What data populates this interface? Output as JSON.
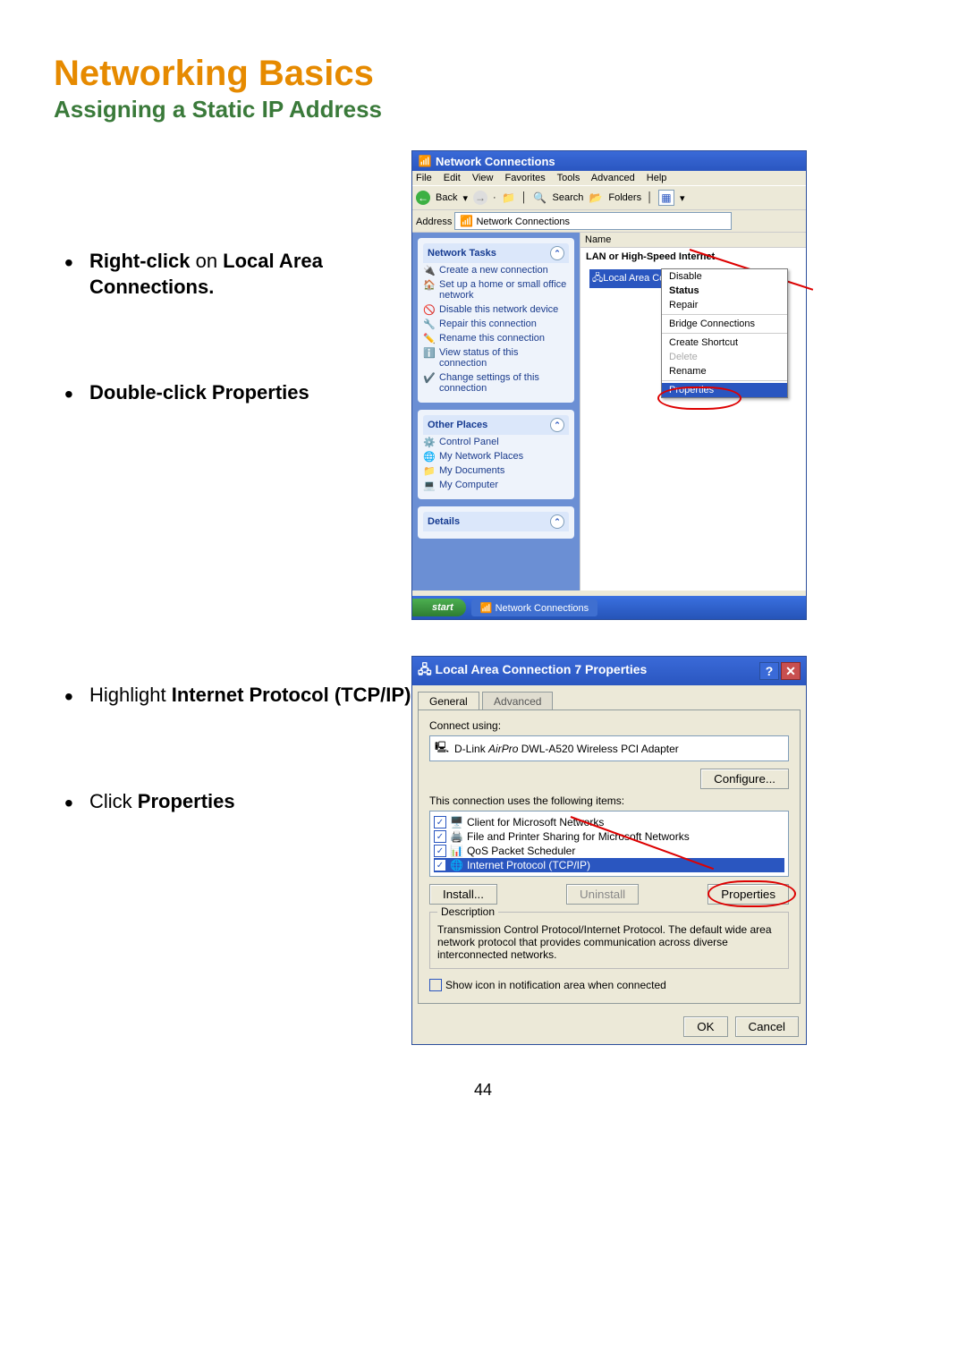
{
  "page": {
    "title": "Networking Basics",
    "subtitle": "Assigning a Static IP Address",
    "number": "44"
  },
  "instructions": {
    "step1a": "Right-click",
    "step1b": " on ",
    "step1c": "Local Area Connections.",
    "step2a": "Double-click Properties",
    "step3a": "Highlight ",
    "step3b": "Internet Protocol (TCP/IP)",
    "step4a": "Click ",
    "step4b": "Properties"
  },
  "nc": {
    "title": "Network Connections",
    "menu": {
      "file": "File",
      "edit": "Edit",
      "view": "View",
      "fav": "Favorites",
      "tools": "Tools",
      "adv": "Advanced",
      "help": "Help"
    },
    "tb": {
      "back": "Back",
      "search": "Search",
      "folders": "Folders"
    },
    "addr_label": "Address",
    "addr_value": "Network Connections",
    "col_name": "Name",
    "group": "LAN or High-Speed Internet",
    "conn": "Local Area Conn",
    "tasks_hdr": "Network Tasks",
    "tasks": [
      "Create a new connection",
      "Set up a home or small office network",
      "Disable this network device",
      "Repair this connection",
      "Rename this connection",
      "View status of this connection",
      "Change settings of this connection"
    ],
    "other_hdr": "Other Places",
    "other": [
      "Control Panel",
      "My Network Places",
      "My Documents",
      "My Computer"
    ],
    "details_hdr": "Details",
    "ctx": {
      "disable": "Disable",
      "status": "Status",
      "repair": "Repair",
      "bridge": "Bridge Connections",
      "shortcut": "Create Shortcut",
      "delete": "Delete",
      "rename": "Rename",
      "props": "Properties"
    },
    "start": "start",
    "task_item": "Network Connections"
  },
  "dlg": {
    "title": "Local Area Connection 7 Properties",
    "tab_general": "General",
    "tab_adv": "Advanced",
    "connect_using": "Connect using:",
    "adapter_prefix": "D-Link ",
    "adapter_em": "AirPro",
    "adapter_suffix": " DWL-A520 Wireless PCI Adapter",
    "configure": "Configure...",
    "uses": "This connection uses the following items:",
    "items": [
      "Client for Microsoft Networks",
      "File and Printer Sharing for Microsoft Networks",
      "QoS Packet Scheduler",
      "Internet Protocol (TCP/IP)"
    ],
    "install": "Install...",
    "uninstall": "Uninstall",
    "properties": "Properties",
    "desc_label": "Description",
    "desc": "Transmission Control Protocol/Internet Protocol. The default wide area network protocol that provides communication across diverse interconnected networks.",
    "show_icon": "Show icon in notification area when connected",
    "ok": "OK",
    "cancel": "Cancel"
  }
}
